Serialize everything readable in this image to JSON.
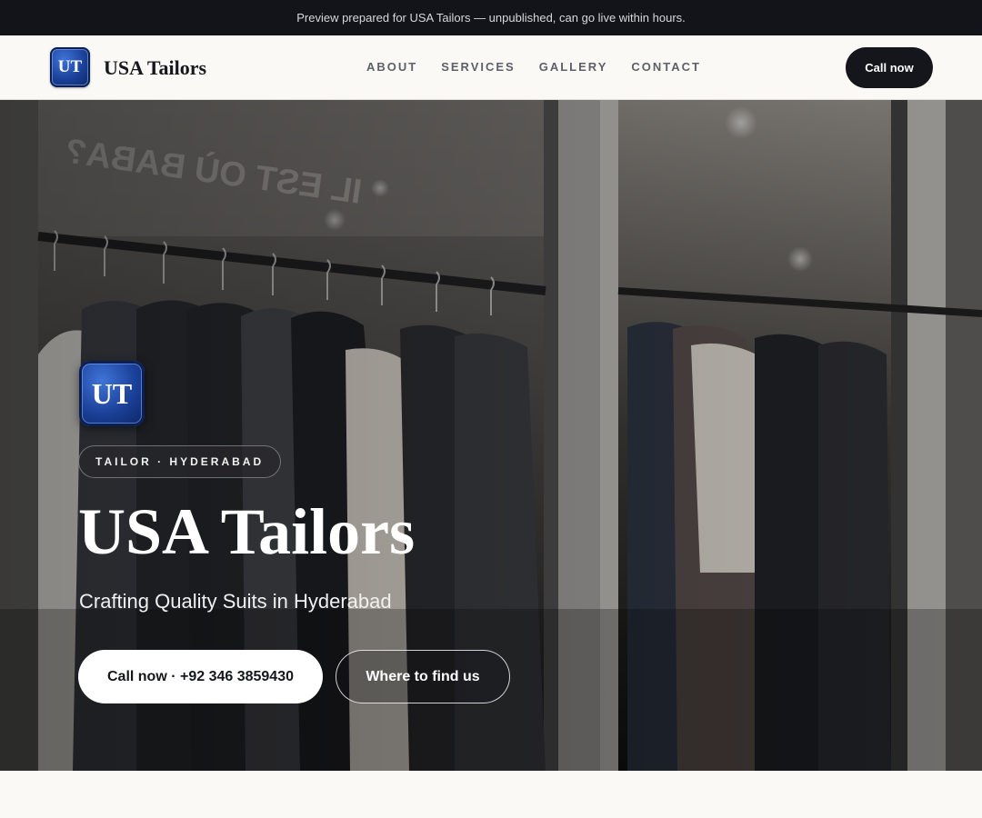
{
  "preview_banner": {
    "text": "Preview prepared for USA Tailors — unpublished, can go live within hours."
  },
  "header": {
    "logo_monogram": "UT",
    "brand_name": "USA Tailors",
    "nav": [
      "ABOUT",
      "SERVICES",
      "GALLERY",
      "CONTACT"
    ],
    "cta_label": "Call now"
  },
  "hero": {
    "logo_monogram": "UT",
    "eyebrow": "TAILOR · HYDERABAD",
    "title": "USA Tailors",
    "subtitle": "Crafting Quality Suits in Hyderabad",
    "primary_cta": "Call now · +92 346 3859430",
    "secondary_cta": "Where to find us"
  },
  "colors": {
    "dark": "#14161b",
    "page_background": "#faf9f6",
    "logo_blue": "#1a3f96",
    "white": "#ffffff"
  }
}
